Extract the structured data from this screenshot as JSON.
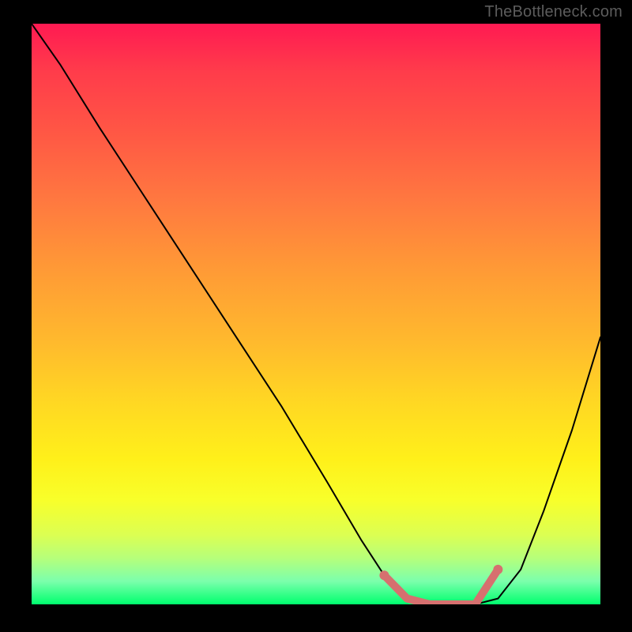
{
  "watermark": "TheBottleneck.com",
  "chart_data": {
    "type": "line",
    "title": "",
    "xlabel": "",
    "ylabel": "",
    "xlim": [
      0,
      100
    ],
    "ylim": [
      0,
      100
    ],
    "grid": false,
    "legend": false,
    "gradient_stops": [
      {
        "pos": 0,
        "color": "#ff1a52"
      },
      {
        "pos": 8,
        "color": "#ff3b4b"
      },
      {
        "pos": 18,
        "color": "#ff5545"
      },
      {
        "pos": 30,
        "color": "#ff7740"
      },
      {
        "pos": 42,
        "color": "#ff9936"
      },
      {
        "pos": 55,
        "color": "#ffba2d"
      },
      {
        "pos": 65,
        "color": "#ffd723"
      },
      {
        "pos": 75,
        "color": "#fff01a"
      },
      {
        "pos": 82,
        "color": "#f8ff2a"
      },
      {
        "pos": 88,
        "color": "#dcff52"
      },
      {
        "pos": 92,
        "color": "#b6ff7a"
      },
      {
        "pos": 96,
        "color": "#7cffac"
      },
      {
        "pos": 100,
        "color": "#00ff6e"
      }
    ],
    "series": [
      {
        "name": "bottleneck-curve",
        "x": [
          0,
          5,
          12,
          20,
          28,
          36,
          44,
          52,
          58,
          62,
          66,
          70,
          74,
          78,
          82,
          86,
          90,
          95,
          100
        ],
        "y": [
          100,
          93,
          82,
          70,
          58,
          46,
          34,
          21,
          11,
          5,
          1,
          0,
          0,
          0,
          1,
          6,
          16,
          30,
          46
        ]
      }
    ],
    "highlight": {
      "name": "optimal-range",
      "color": "#d6706f",
      "x": [
        62,
        66,
        70,
        74,
        78,
        82
      ],
      "y": [
        5,
        1,
        0,
        0,
        0,
        6
      ]
    }
  }
}
